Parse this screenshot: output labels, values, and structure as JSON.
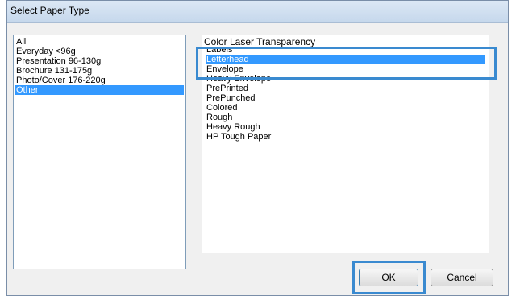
{
  "dialog": {
    "title": "Select Paper Type",
    "ok_label": "OK",
    "cancel_label": "Cancel"
  },
  "left_list": {
    "items": [
      "All",
      "Everyday <96g",
      "Presentation 96-130g",
      "Brochure 131-175g",
      "Photo/Cover 176-220g",
      "Other"
    ],
    "selected": "Other"
  },
  "right_list": {
    "first_item": "Color Laser Transparency",
    "items": [
      "Labels",
      "Letterhead",
      "Envelope",
      "Heavy Envelope",
      "PrePrinted",
      "PrePunched",
      "Colored",
      "Rough",
      "Heavy Rough",
      "HP Tough Paper"
    ],
    "selected": "Letterhead"
  },
  "colors": {
    "selection": "#3399ff",
    "highlight_border": "#3a8ad0"
  }
}
